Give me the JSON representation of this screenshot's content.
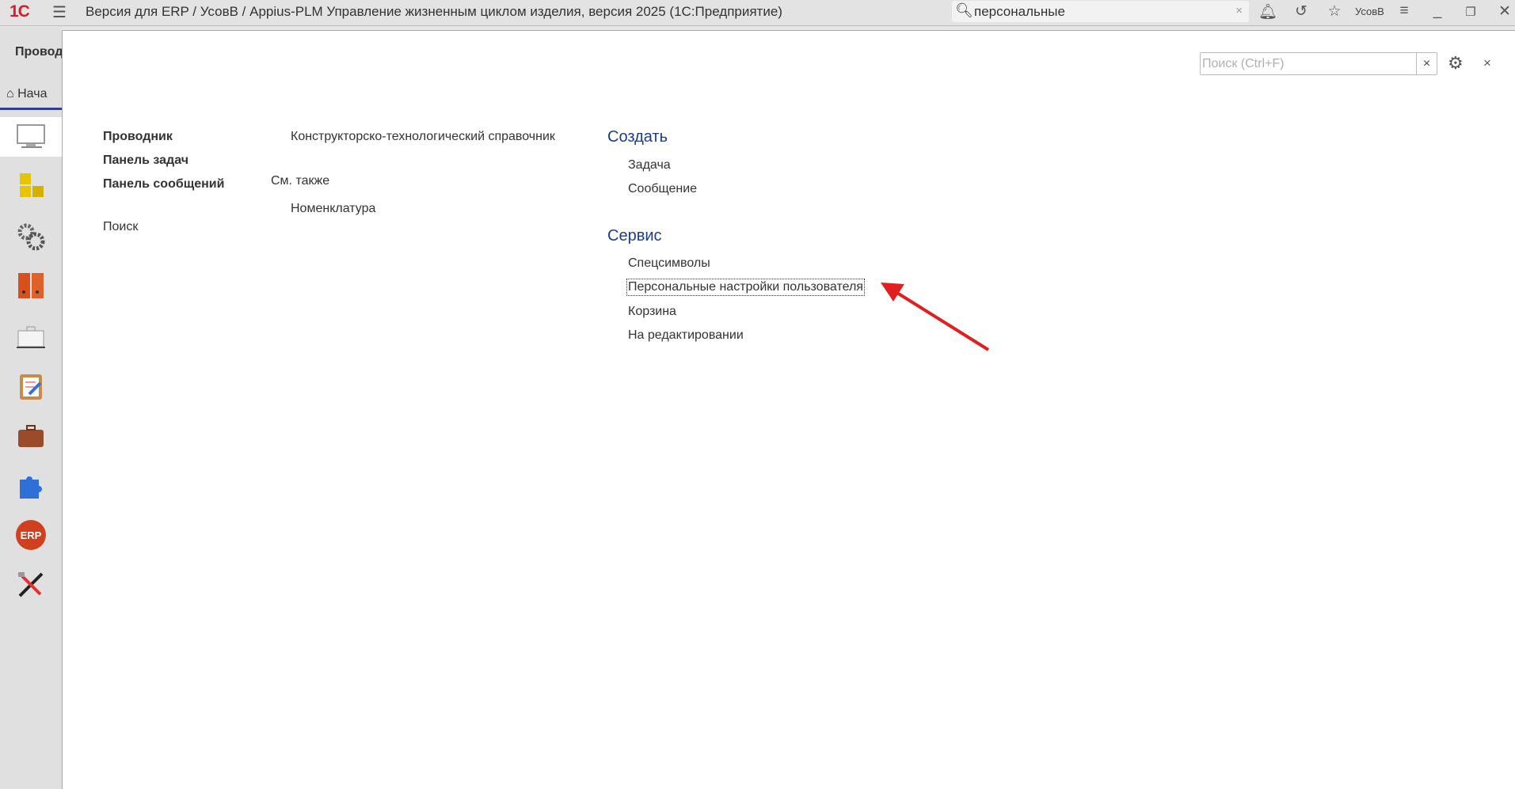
{
  "window": {
    "logo": "1С",
    "title": "Версия для ERP / УсовВ / Appius-PLM Управление жизненным циклом изделия, версия 2025  (1С:Предприятие)",
    "user": "УсовВ"
  },
  "global_search": {
    "value": "персональные",
    "clear": "×"
  },
  "sidebar": {
    "section_label": "Провод",
    "home_tab": "Нача",
    "icons": [
      "monitor-icon",
      "blocks-icon",
      "gears-icon",
      "folders-icon",
      "case-icon",
      "clipboard-icon",
      "briefcase-icon",
      "puzzle-icon",
      "erp-icon",
      "tools-icon"
    ],
    "erp_badge": "ERP"
  },
  "panel": {
    "search_placeholder": "Поиск (Ctrl+F)",
    "clear": "×",
    "close": "×",
    "col1": [
      "Проводник",
      "Панель задач",
      "Панель сообщений"
    ],
    "search_link": "Поиск",
    "col2": {
      "main": "Конструкторско-технологический справочник",
      "see_also": "См. также",
      "see_also_items": [
        "Номенклатура"
      ]
    },
    "create": {
      "title": "Создать",
      "items": [
        "Задача",
        "Сообщение"
      ]
    },
    "service": {
      "title": "Сервис",
      "items": [
        "Спецсимволы",
        "Персональные настройки пользователя",
        "Корзина",
        "На редактировании"
      ]
    }
  },
  "colors": {
    "accent": "#1c3c94",
    "logo": "#d0202a",
    "annotation_arrow": "#e02020"
  }
}
